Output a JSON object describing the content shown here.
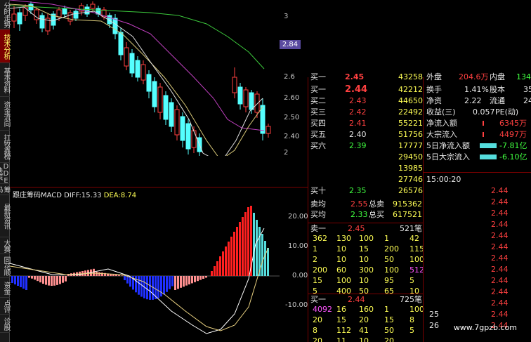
{
  "tabs": [
    "分时走势",
    "技术分析",
    "基本资料",
    "资金流向",
    "扛牧鑫榜",
    "DDE决策",
    "筹码",
    "最新资讯",
    "大赛",
    "同花顺",
    "资金",
    "点评",
    "诊股"
  ],
  "active_tab": 1,
  "main_axis_ticks": [
    "3",
    "2.84",
    "2.6",
    "2.60",
    "2.50",
    "2.40",
    "2"
  ],
  "price_tag": "2.84",
  "macd": {
    "title": "跟庄筹码MACD",
    "diff_label": "DIFF:",
    "diff": "15.33",
    "dea_label": "DEA:",
    "dea": "8.74"
  },
  "macd_axis_ticks": [
    "20.00",
    "10.00",
    "0.00",
    "-10.00"
  ],
  "book": {
    "partial_top": [
      {
        "label": "买一",
        "price": "2.45",
        "vol": "43258"
      }
    ],
    "rows": [
      {
        "label": "买一",
        "price": "2.44",
        "vol": "42212"
      },
      {
        "label": "买二",
        "price": "2.43",
        "vol": "44650"
      },
      {
        "label": "买三",
        "price": "2.42",
        "vol": "22492"
      },
      {
        "label": "买四",
        "price": "2.41",
        "vol": "55221"
      },
      {
        "label": "买五",
        "price": "2.40",
        "vol": "51756"
      },
      {
        "label": "买六",
        "price": "2.39",
        "vol": "17777"
      },
      {
        "label": "",
        "price": "",
        "vol": "29450"
      },
      {
        "label": "",
        "price": "",
        "vol": "13985"
      },
      {
        "label": "",
        "price": "",
        "vol": "27746"
      },
      {
        "label": "买十",
        "price": "2.35",
        "vol": "26576"
      }
    ],
    "avg_sell": {
      "label": "卖均",
      "price": "2.55",
      "total_label": "总卖",
      "total": "915362"
    },
    "avg_buy": {
      "label": "买均",
      "price": "2.33",
      "total_label": "总买",
      "total": "617521"
    },
    "sell_queue": {
      "label": "卖一",
      "price": "2.45",
      "count": "521笔",
      "rows": [
        [
          "362",
          "130",
          "100",
          "1",
          "42"
        ],
        [
          "1",
          "10",
          "15",
          "200",
          "115"
        ],
        [
          "2",
          "10",
          "10",
          "50",
          "100"
        ],
        [
          "200",
          "60",
          "300",
          "100",
          "512"
        ],
        [
          "15",
          "100",
          "10",
          "95",
          "5"
        ],
        [
          "5",
          "400",
          "50",
          "65",
          "10"
        ]
      ]
    },
    "buy_queue": {
      "label": "买一",
      "price": "2.44",
      "count": "725笔",
      "rows": [
        [
          "4092",
          "16",
          "160",
          "1",
          "100"
        ],
        [
          "20",
          "15",
          "20",
          "15",
          "8"
        ],
        [
          "8",
          "112",
          "41",
          "50",
          "5"
        ],
        [
          "20",
          "11",
          "10",
          "20",
          ""
        ]
      ]
    }
  },
  "stats": {
    "top": {
      "a": "外盘",
      "b": "204.6万",
      "c": "内盘",
      "d": "134"
    },
    "rows": [
      {
        "k1": "换手",
        "v1": "1.41%",
        "k2": "股本",
        "v2": "35"
      },
      {
        "k1": "净资",
        "v1": "2.22",
        "k2": "流通",
        "v2": "24"
      },
      {
        "k1": "收益(三)",
        "v1": "0.057",
        "k2": "PE(动)",
        "v2": ""
      },
      {
        "k1": "净流入额",
        "v1": "6345万"
      },
      {
        "k1": "大宗流入",
        "v1": "4497万"
      },
      {
        "k1": "5日净流入额",
        "v1": "-7.81亿"
      },
      {
        "k1": "5日大宗流入",
        "v1": "-6.10亿"
      }
    ]
  },
  "ticks": {
    "time": "15:00:20",
    "rows": [
      {
        "n": "",
        "p": "2.44"
      },
      {
        "n": "",
        "p": "2.44"
      },
      {
        "n": "",
        "p": "2.44"
      },
      {
        "n": "",
        "p": "2.44"
      },
      {
        "n": "",
        "p": "2.44"
      },
      {
        "n": "",
        "p": "2.44"
      },
      {
        "n": "",
        "p": "2.44"
      },
      {
        "n": "",
        "p": "2.44"
      },
      {
        "n": "",
        "p": "2.44"
      },
      {
        "n": "",
        "p": "2.44"
      },
      {
        "n": "",
        "p": "2.44"
      },
      {
        "n": "25",
        "p": "2.44"
      },
      {
        "n": "26",
        "p": "2.44"
      }
    ]
  },
  "watermark": "www.7gpzb.com"
}
